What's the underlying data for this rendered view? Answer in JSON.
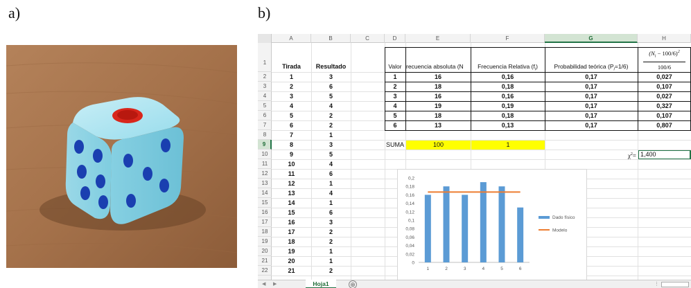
{
  "labels": {
    "a": "a)",
    "b": "b)"
  },
  "sheet": {
    "columns": [
      "A",
      "B",
      "C",
      "D",
      "E",
      "F",
      "G",
      "H"
    ],
    "selected_column": "G",
    "rows": [
      "1",
      "2",
      "3",
      "4",
      "5",
      "6",
      "7",
      "8",
      "9",
      "10",
      "11",
      "12",
      "13",
      "14",
      "15",
      "16",
      "17",
      "18",
      "19",
      "20",
      "21",
      "22"
    ],
    "selected_row": "9",
    "headers": {
      "tirada": "Tirada",
      "resultado": "Resultado",
      "valor": "Valor",
      "freq_abs": "recuencia absoluta (N",
      "freq_rel": "Frecuencia Relativa (f",
      "freq_rel_sub": "i",
      "freq_rel_close": ")",
      "prob": "Probabilidad teórica (P",
      "prob_sub": "i",
      "prob_eq": "=1/6)",
      "chi_num": "(N",
      "chi_num_sub": "i",
      "chi_num_rest": " − 100/6)",
      "chi_num_sup": "2",
      "chi_den": "100/6"
    },
    "tiradas": [
      [
        "1",
        "3"
      ],
      [
        "2",
        "6"
      ],
      [
        "3",
        "5"
      ],
      [
        "4",
        "4"
      ],
      [
        "5",
        "2"
      ],
      [
        "6",
        "2"
      ],
      [
        "7",
        "1"
      ],
      [
        "8",
        "3"
      ],
      [
        "9",
        "5"
      ],
      [
        "10",
        "4"
      ],
      [
        "11",
        "6"
      ],
      [
        "12",
        "1"
      ],
      [
        "13",
        "4"
      ],
      [
        "14",
        "1"
      ],
      [
        "15",
        "6"
      ],
      [
        "16",
        "3"
      ],
      [
        "17",
        "2"
      ],
      [
        "18",
        "2"
      ],
      [
        "19",
        "1"
      ],
      [
        "20",
        "1"
      ],
      [
        "21",
        "2"
      ]
    ],
    "table": [
      [
        "1",
        "16",
        "0,16",
        "0,17",
        "0,027"
      ],
      [
        "2",
        "18",
        "0,18",
        "0,17",
        "0,107"
      ],
      [
        "3",
        "16",
        "0,16",
        "0,17",
        "0,027"
      ],
      [
        "4",
        "19",
        "0,19",
        "0,17",
        "0,327"
      ],
      [
        "5",
        "18",
        "0,18",
        "0,17",
        "0,107"
      ],
      [
        "6",
        "13",
        "0,13",
        "0,17",
        "0,807"
      ]
    ],
    "suma_label": "SUMA",
    "suma_abs": "100",
    "suma_rel": "1",
    "chi_label": "χ",
    "chi_label_sup": "2",
    "chi_label_eq": "=",
    "chi_value": "1,400",
    "tab_name": "Hoja1",
    "add_sheet": "⊕"
  },
  "chart_data": {
    "type": "bar",
    "categories": [
      "1",
      "2",
      "3",
      "4",
      "5",
      "6"
    ],
    "series": [
      {
        "name": "Dado físico",
        "values": [
          0.16,
          0.18,
          0.16,
          0.19,
          0.18,
          0.13
        ],
        "color": "#5b9bd5"
      }
    ],
    "line": {
      "name": "Modelo",
      "value": 0.1667,
      "color": "#ed7d31"
    },
    "yticks": [
      "0",
      "0,02",
      "0,04",
      "0,06",
      "0,08",
      "0,1",
      "0,12",
      "0,14",
      "0,16",
      "0,18",
      "0,2"
    ],
    "ylim": [
      0,
      0.2
    ],
    "legend": "right",
    "grid": false
  },
  "colors": {
    "accent": "#217346",
    "highlight": "#ffff00",
    "die_body": "#8fd6e6",
    "pip_blue": "#1a3fb0",
    "pip_red": "#d8261b"
  }
}
